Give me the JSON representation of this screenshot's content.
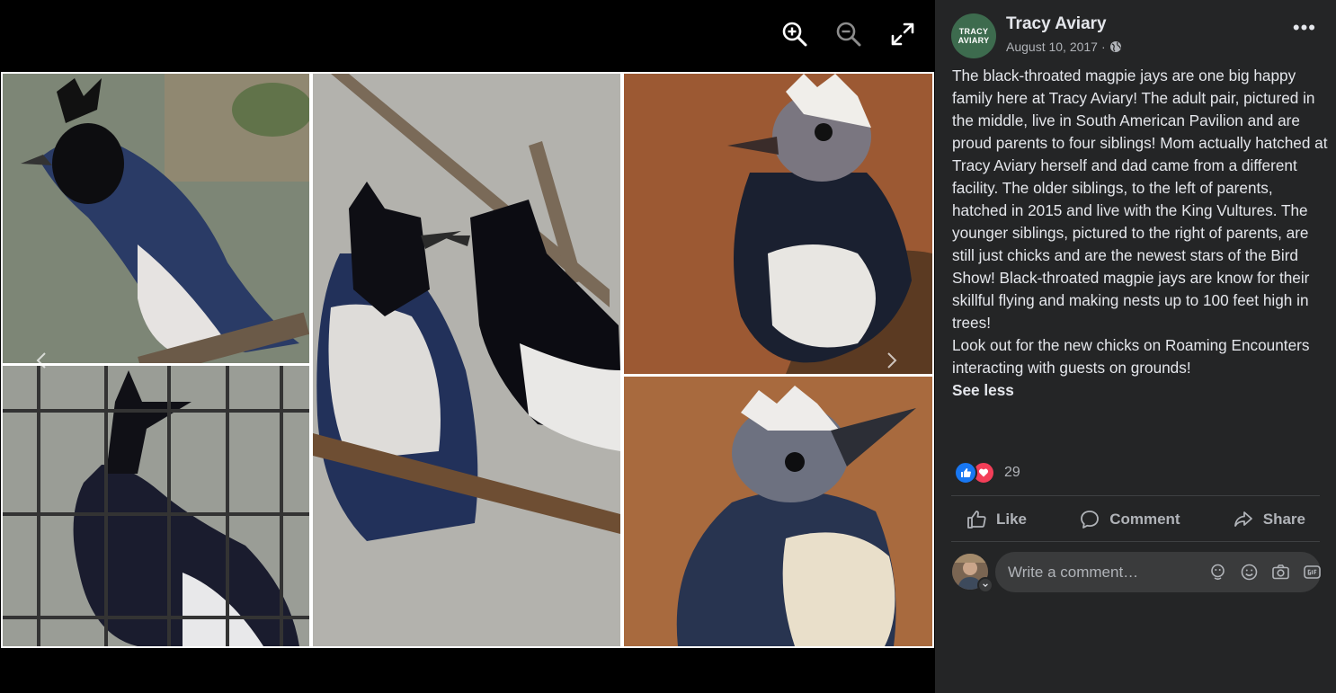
{
  "viewer": {
    "toolbar": [
      "zoom-in",
      "zoom-out",
      "fullscreen"
    ],
    "photos": [
      {
        "name": "photo-jay-perched",
        "bg": "#7f8a7a"
      },
      {
        "name": "photo-jay-cage",
        "bg": "#8c8f88"
      },
      {
        "name": "photo-jay-pair",
        "bg": "#b5b4ae"
      },
      {
        "name": "photo-chick-1",
        "bg": "#9d5a33"
      },
      {
        "name": "photo-chick-2",
        "bg": "#a96a3f"
      }
    ]
  },
  "post": {
    "page_name": "Tracy Aviary",
    "avatar_lines": [
      "TRACY",
      "AVIARY"
    ],
    "date": "August 10, 2017",
    "separator": "·",
    "more_label": "•••",
    "paragraph_1": "The black-throated magpie jays are one big happy family here at Tracy Aviary! The adult pair, pictured in the middle, live in South American Pavilion and are proud parents to four siblings! Mom actually hatched at Tracy Aviary herself and dad came from a different facility. The older siblings, to the left of parents, hatched in 2015 and live with the King Vultures. The younger siblings, pictured to the right of parents, are still just chicks and are the newest stars of the Bird Show! Black-throated magpie jays are know for their skillful flying and making nests up to 100 feet high in trees!",
    "paragraph_2": "Look out for the new chicks on Roaming Encounters interacting with guests on grounds!",
    "see_less": "See less",
    "reaction_count": "29",
    "actions": {
      "like": "Like",
      "comment": "Comment",
      "share": "Share"
    },
    "comment_placeholder": "Write a comment…"
  },
  "colors": {
    "panel_bg": "#242526",
    "text_primary": "#e4e6eb",
    "text_secondary": "#b0b3b8",
    "like_blue": "#1877f2",
    "love_red": "#f33e58",
    "avatar_green": "#3d6b4e"
  }
}
